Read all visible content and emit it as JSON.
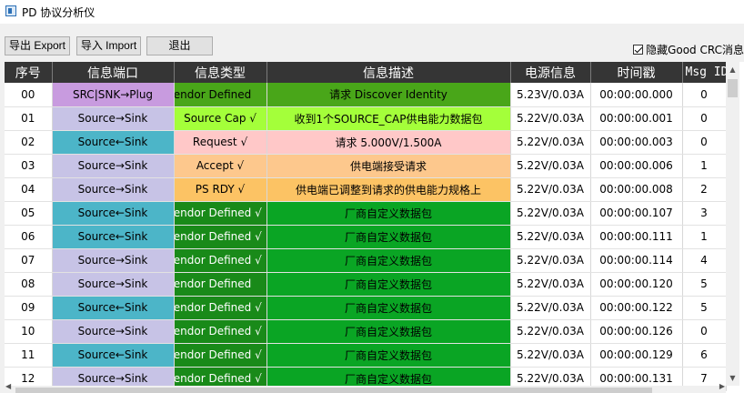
{
  "window": {
    "title": "PD 协议分析仪"
  },
  "toolbar": {
    "export_label": "导出 Export",
    "import_label": "导入 Import",
    "exit_label": "退出",
    "hide_crc_label": "隐藏Good CRC消息",
    "hide_crc_checked": true
  },
  "table": {
    "headers": [
      "序号",
      "信息端口",
      "信息类型",
      "信息描述",
      "电源信息",
      "时间戳",
      "Msg ID"
    ],
    "rows": [
      {
        "seq": "00",
        "dir": "SRC|SNK→Plug",
        "type": "Vendor Defined",
        "desc": "请求 Discover Identity",
        "power": "5.23V/0.03A",
        "time": "00:00:00.000",
        "id": "0",
        "dir_bg": "#c89bdf",
        "type_bg": "#49a619",
        "desc_bg": "#49a619",
        "type_color": "#000",
        "desc_color": "#000"
      },
      {
        "seq": "01",
        "dir": "Source→Sink",
        "type": "Source Cap √",
        "desc": "收到1个SOURCE_CAP供电能力数据包",
        "power": "5.22V/0.03A",
        "time": "00:00:00.001",
        "id": "0",
        "dir_bg": "#c7c3e6",
        "type_bg": "#a4ff3a",
        "desc_bg": "#a4ff3a",
        "type_color": "#000",
        "desc_color": "#000"
      },
      {
        "seq": "02",
        "dir": "Source←Sink",
        "type": "Request √",
        "desc": "请求 5.000V/1.500A",
        "power": "5.22V/0.03A",
        "time": "00:00:00.003",
        "id": "0",
        "dir_bg": "#4cb5c8",
        "type_bg": "#ffc8c8",
        "desc_bg": "#ffc8c8",
        "type_color": "#000",
        "desc_color": "#000"
      },
      {
        "seq": "03",
        "dir": "Source→Sink",
        "type": "Accept √",
        "desc": "供电端接受请求",
        "power": "5.22V/0.03A",
        "time": "00:00:00.006",
        "id": "1",
        "dir_bg": "#c7c3e6",
        "type_bg": "#fdc88d",
        "desc_bg": "#fdc88d",
        "type_color": "#000",
        "desc_color": "#000"
      },
      {
        "seq": "04",
        "dir": "Source→Sink",
        "type": "PS RDY √",
        "desc": "供电端已调整到请求的供电能力规格上",
        "power": "5.22V/0.03A",
        "time": "00:00:00.008",
        "id": "2",
        "dir_bg": "#c7c3e6",
        "type_bg": "#fcc364",
        "desc_bg": "#fcc364",
        "type_color": "#000",
        "desc_color": "#000"
      },
      {
        "seq": "05",
        "dir": "Source←Sink",
        "type": "Vendor Defined √",
        "desc": "厂商自定义数据包",
        "power": "5.22V/0.03A",
        "time": "00:00:00.107",
        "id": "3",
        "dir_bg": "#4cb5c8",
        "type_bg": "#198a19",
        "desc_bg": "#0aa524",
        "type_color": "#fff",
        "desc_color": "#000"
      },
      {
        "seq": "06",
        "dir": "Source←Sink",
        "type": "Vendor Defined √",
        "desc": "厂商自定义数据包",
        "power": "5.22V/0.03A",
        "time": "00:00:00.111",
        "id": "1",
        "dir_bg": "#4cb5c8",
        "type_bg": "#198a19",
        "desc_bg": "#0aa524",
        "type_color": "#fff",
        "desc_color": "#000"
      },
      {
        "seq": "07",
        "dir": "Source→Sink",
        "type": "Vendor Defined √",
        "desc": "厂商自定义数据包",
        "power": "5.22V/0.03A",
        "time": "00:00:00.114",
        "id": "4",
        "dir_bg": "#c7c3e6",
        "type_bg": "#198a19",
        "desc_bg": "#0aa524",
        "type_color": "#fff",
        "desc_color": "#000"
      },
      {
        "seq": "08",
        "dir": "Source→Sink",
        "type": "Vendor Defined",
        "desc": "厂商自定义数据包",
        "power": "5.22V/0.03A",
        "time": "00:00:00.120",
        "id": "5",
        "dir_bg": "#c7c3e6",
        "type_bg": "#198a19",
        "desc_bg": "#0aa524",
        "type_color": "#fff",
        "desc_color": "#000"
      },
      {
        "seq": "09",
        "dir": "Source←Sink",
        "type": "Vendor Defined √",
        "desc": "厂商自定义数据包",
        "power": "5.22V/0.03A",
        "time": "00:00:00.122",
        "id": "5",
        "dir_bg": "#4cb5c8",
        "type_bg": "#198a19",
        "desc_bg": "#0aa524",
        "type_color": "#fff",
        "desc_color": "#000"
      },
      {
        "seq": "10",
        "dir": "Source→Sink",
        "type": "Vendor Defined √",
        "desc": "厂商自定义数据包",
        "power": "5.22V/0.03A",
        "time": "00:00:00.126",
        "id": "0",
        "dir_bg": "#c7c3e6",
        "type_bg": "#198a19",
        "desc_bg": "#0aa524",
        "type_color": "#fff",
        "desc_color": "#000"
      },
      {
        "seq": "11",
        "dir": "Source←Sink",
        "type": "Vendor Defined √",
        "desc": "厂商自定义数据包",
        "power": "5.22V/0.03A",
        "time": "00:00:00.129",
        "id": "6",
        "dir_bg": "#4cb5c8",
        "type_bg": "#198a19",
        "desc_bg": "#0aa524",
        "type_color": "#fff",
        "desc_color": "#000"
      },
      {
        "seq": "12",
        "dir": "Source→Sink",
        "type": "Vendor Defined √",
        "desc": "厂商自定义数据包",
        "power": "5.22V/0.03A",
        "time": "00:00:00.131",
        "id": "7",
        "dir_bg": "#c7c3e6",
        "type_bg": "#198a19",
        "desc_bg": "#0aa524",
        "type_color": "#fff",
        "desc_color": "#000"
      }
    ]
  },
  "icons": {
    "app": "app-window-icon",
    "checkbox": "check-icon",
    "scroll_up": "arrow-up-icon",
    "scroll_down": "arrow-down-icon",
    "scroll_left": "arrow-left-icon",
    "scroll_right": "arrow-right-icon"
  },
  "colors": {
    "header_bg": "#353535",
    "header_fg": "#ffffff"
  }
}
